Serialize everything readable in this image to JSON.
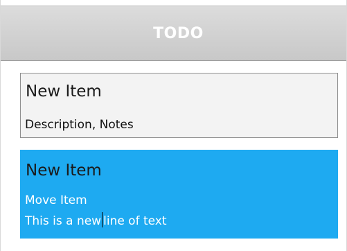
{
  "header": {
    "title": "TODO"
  },
  "items": [
    {
      "title": "New Item",
      "description": "Description, Notes"
    },
    {
      "title": "New Item",
      "description_lines": [
        "Move Item",
        "This is a new line of text"
      ],
      "edit": {
        "before_caret": "This is a new",
        "after_caret": "line of text"
      }
    }
  ],
  "colors": {
    "header_background": "#d4d4d4",
    "selected_item_background": "#1eaaf1",
    "item_background": "#f3f3f3",
    "item_border": "#8f8f8f"
  }
}
